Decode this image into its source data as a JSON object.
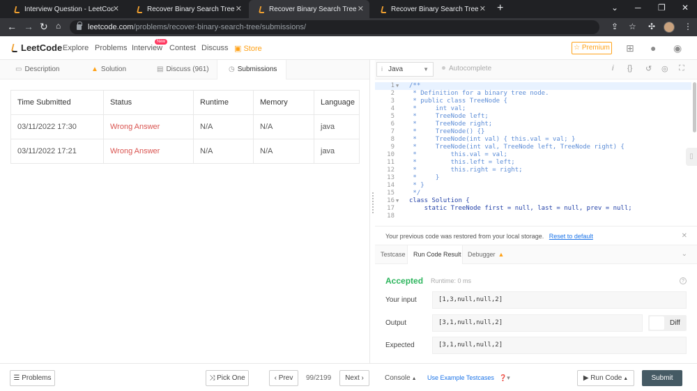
{
  "browser": {
    "tabs": [
      {
        "title": "Interview Question - LeetCode D"
      },
      {
        "title": "Recover Binary Search Tree - Sub"
      },
      {
        "title": "Recover Binary Search Tree - Leet"
      },
      {
        "title": "Recover Binary Search Tree - Sub"
      }
    ],
    "url_host": "leetcode.com",
    "url_path": "/problems/recover-binary-search-tree/submissions/"
  },
  "nav": {
    "logo": "LeetCode",
    "links": [
      "Explore",
      "Problems",
      "Interview",
      "Contest",
      "Discuss"
    ],
    "new_badge": "New",
    "store": "Store",
    "premium": "Premium"
  },
  "left_tabs": [
    "Description",
    "Solution",
    "Discuss (961)",
    "Submissions"
  ],
  "submissions": {
    "headers": [
      "Time Submitted",
      "Status",
      "Runtime",
      "Memory",
      "Language"
    ],
    "rows": [
      [
        "03/11/2022 17:30",
        "Wrong Answer",
        "N/A",
        "N/A",
        "java"
      ],
      [
        "03/11/2022 17:21",
        "Wrong Answer",
        "N/A",
        "N/A",
        "java"
      ]
    ]
  },
  "editor": {
    "language": "Java",
    "autocomplete": "Autocomplete",
    "lines": [
      "/**",
      " * Definition for a binary tree node.",
      " * public class TreeNode {",
      " *     int val;",
      " *     TreeNode left;",
      " *     TreeNode right;",
      " *     TreeNode() {}",
      " *     TreeNode(int val) { this.val = val; }",
      " *     TreeNode(int val, TreeNode left, TreeNode right) {",
      " *         this.val = val;",
      " *         this.left = left;",
      " *         this.right = right;",
      " *     }",
      " * }",
      " */",
      "class Solution {",
      "    static TreeNode first = null, last = null, prev = null;",
      ""
    ]
  },
  "notice": {
    "text": "Your previous code was restored from your local storage.",
    "reset": "Reset to default"
  },
  "console": {
    "tabs": [
      "Testcase",
      "Run Code Result",
      "Debugger"
    ],
    "status": "Accepted",
    "runtime": "Runtime: 0 ms",
    "labels": [
      "Your input",
      "Output",
      "Expected"
    ],
    "input": "[1,3,null,null,2]",
    "output": "[3,1,null,null,2]",
    "expected": "[3,1,null,null,2]",
    "diff": "Diff"
  },
  "bottom": {
    "problems": "Problems",
    "pick_one": "Pick One",
    "prev": "Prev",
    "page": "99/2199",
    "next": "Next",
    "console": "Console",
    "use_example": "Use Example Testcases",
    "run_code": "Run Code",
    "submit": "Submit"
  }
}
